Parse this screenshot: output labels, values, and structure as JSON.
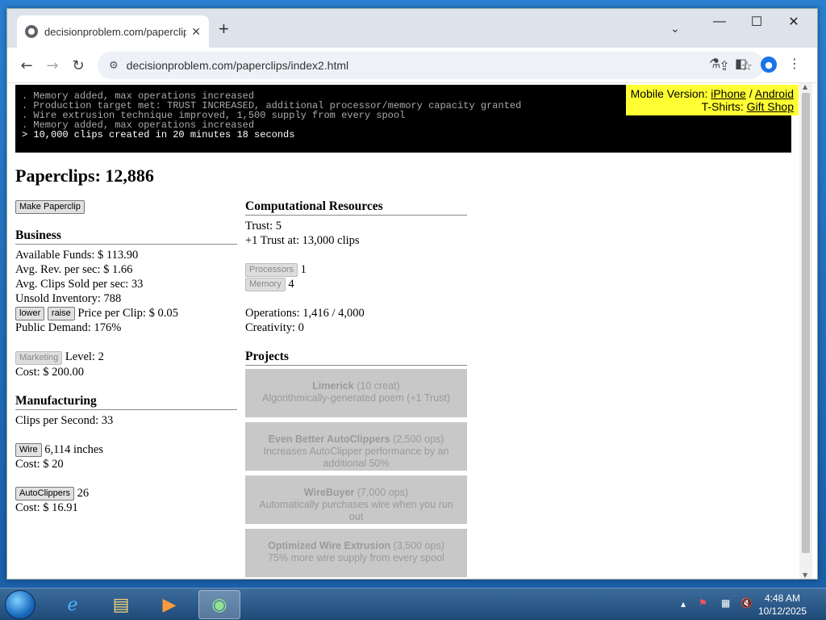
{
  "browser": {
    "tab_title": "decisionproblem.com/paperclip",
    "tab_close": "✕",
    "new_tab": "+",
    "tab_dropdown": "⌄",
    "minimize": "—",
    "maximize": "☐",
    "close": "✕",
    "url": "decisionproblem.com/paperclips/index2.html"
  },
  "console": {
    "lines": [
      ". Memory added, max operations increased",
      ". Production target met: TRUST INCREASED, additional processor/memory capacity granted",
      ". Wire extrusion technique improved, 1,500 supply from every spool",
      ". Memory added, max operations increased"
    ],
    "last": "> 10,000 clips created in 20 minutes 18 seconds"
  },
  "promo": {
    "mobile_label": "Mobile Version:",
    "iphone": "iPhone",
    "sep": "/",
    "android": "Android",
    "tshirt_label": "T-Shirts:",
    "gift_shop": "Gift Shop"
  },
  "title": "Paperclips: 12,886",
  "make_paperclip": "Make Paperclip",
  "business": {
    "heading": "Business",
    "available_funds": "Available Funds: $ 113.90",
    "avg_rev": "Avg. Rev. per sec: $ 1.66",
    "avg_clips_sold": "Avg. Clips Sold per sec: 33",
    "unsold_inventory": "Unsold Inventory: 788",
    "lower": "lower",
    "raise": "raise",
    "price": "Price per Clip: $ 0.05",
    "public_demand": "Public Demand: 176%",
    "marketing": "Marketing",
    "marketing_level": "Level: 2",
    "marketing_cost": "Cost: $ 200.00"
  },
  "manufacturing": {
    "heading": "Manufacturing",
    "clips_per_second": "Clips per Second: 33",
    "wire_button": "Wire",
    "wire_amount": "6,114 inches",
    "wire_cost": "Cost: $ 20",
    "autoclippers_button": "AutoClippers",
    "autoclippers_count": "26",
    "autoclippers_cost": "Cost: $ 16.91"
  },
  "computational": {
    "heading": "Computational Resources",
    "trust": "Trust: 5",
    "next_trust": "+1 Trust at: 13,000 clips",
    "processors_button": "Processors",
    "processors": "1",
    "memory_button": "Memory",
    "memory": "4",
    "operations": "Operations: 1,416 / 4,000",
    "creativity": "Creativity: 0"
  },
  "projects": {
    "heading": "Projects",
    "items": [
      {
        "name": "Limerick",
        "cost": "(10 creat)",
        "desc": "Algorithmically-generated poem (+1 Trust)"
      },
      {
        "name": "Even Better AutoClippers",
        "cost": "(2,500 ops)",
        "desc": "Increases AutoClipper performance by an additional 50%"
      },
      {
        "name": "WireBuyer",
        "cost": "(7,000 ops)",
        "desc": "Automatically purchases wire when you run out"
      },
      {
        "name": "Optimized Wire Extrusion",
        "cost": "(3,500 ops)",
        "desc": "75% more wire supply from every spool"
      }
    ]
  },
  "taskbar": {
    "time": "4:48 AM",
    "date": "10/12/2025"
  }
}
